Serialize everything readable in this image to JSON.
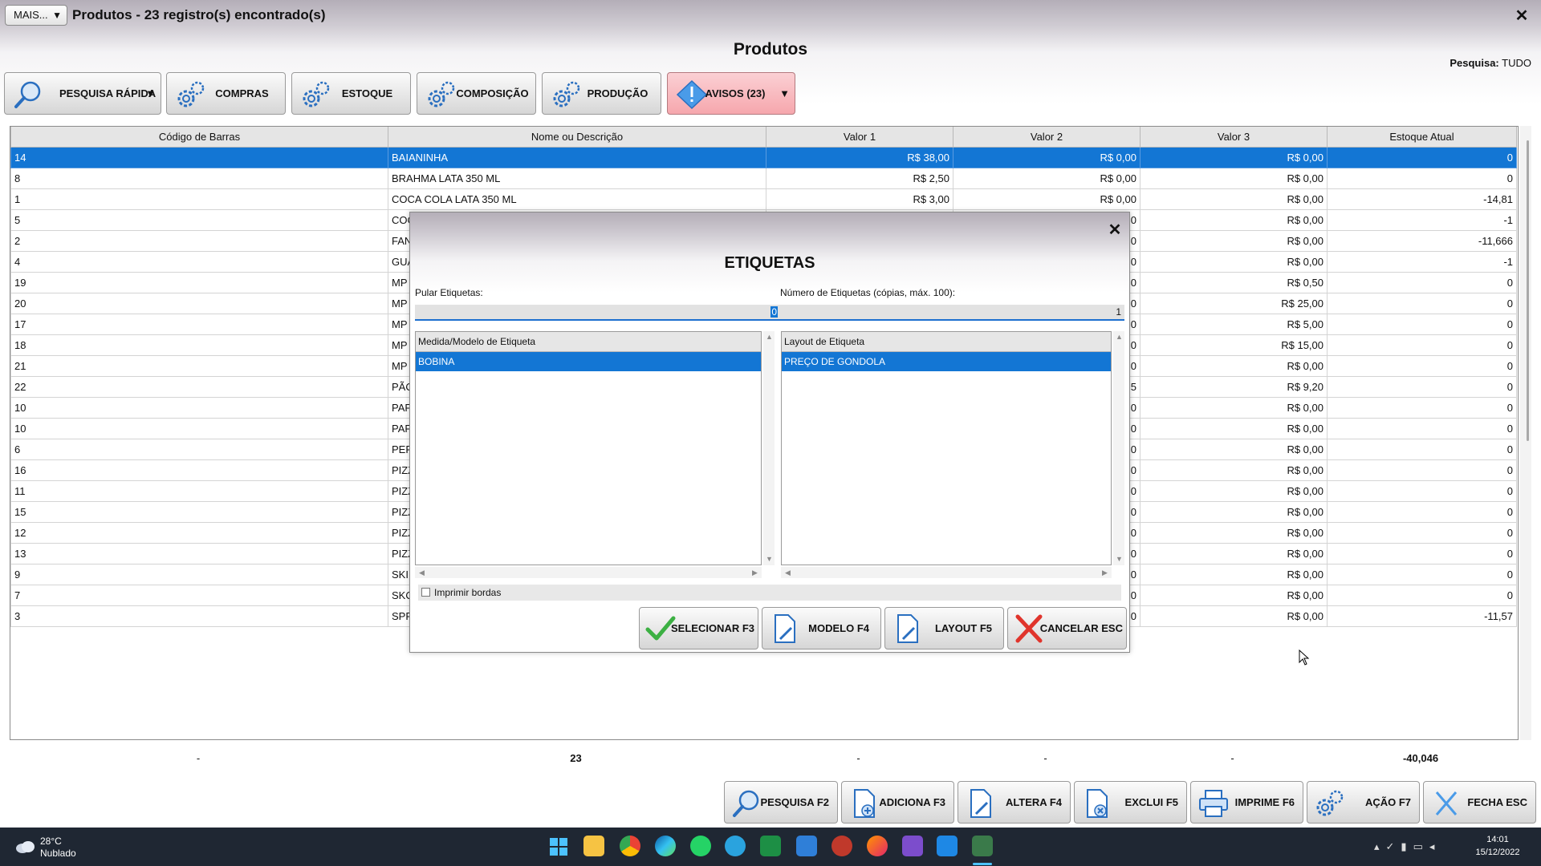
{
  "window": {
    "more_button": "MAIS...",
    "title": "Produtos - 23 registro(s) encontrado(s)",
    "close": "✕",
    "page_title": "Produtos",
    "search_label": "Pesquisa:",
    "search_value": "TUDO"
  },
  "toolbar": {
    "quick_search": "PESQUISA RÁPIDA",
    "compras": "COMPRAS",
    "estoque": "ESTOQUE",
    "composicao": "COMPOSIÇÃO",
    "producao": "PRODUÇÃO",
    "avisos": "AVISOS (23)",
    "dropdown_arrow": "▼"
  },
  "table": {
    "columns": [
      "Código de Barras",
      "Nome ou Descrição",
      "Valor 1",
      "Valor 2",
      "Valor 3",
      "Estoque Atual"
    ],
    "rows": [
      {
        "code": "14",
        "name": "BAIANINHA",
        "v1": "R$ 38,00",
        "v2": "R$ 0,00",
        "v3": "R$ 0,00",
        "stock": "0"
      },
      {
        "code": "8",
        "name": "BRAHMA LATA 350 ML",
        "v1": "R$ 2,50",
        "v2": "R$ 0,00",
        "v3": "R$ 0,00",
        "stock": "0"
      },
      {
        "code": "1",
        "name": "COCA COLA LATA 350 ML",
        "v1": "R$ 3,00",
        "v2": "R$ 0,00",
        "v3": "R$ 0,00",
        "stock": "-14,81"
      },
      {
        "code": "5",
        "name": "COC",
        "v1": "",
        "v2": "0",
        "v3": "R$ 0,00",
        "stock": "-1"
      },
      {
        "code": "2",
        "name": "FAN",
        "v1": "",
        "v2": "0",
        "v3": "R$ 0,00",
        "stock": "-11,666"
      },
      {
        "code": "4",
        "name": "GUA",
        "v1": "",
        "v2": "0",
        "v3": "R$ 0,00",
        "stock": "-1"
      },
      {
        "code": "19",
        "name": "MP",
        "v1": "",
        "v2": "0",
        "v3": "R$ 0,50",
        "stock": "0"
      },
      {
        "code": "20",
        "name": "MP",
        "v1": "",
        "v2": "0",
        "v3": "R$ 25,00",
        "stock": "0"
      },
      {
        "code": "17",
        "name": "MP",
        "v1": "",
        "v2": "0",
        "v3": "R$ 5,00",
        "stock": "0"
      },
      {
        "code": "18",
        "name": "MP",
        "v1": "",
        "v2": "0",
        "v3": "R$ 15,00",
        "stock": "0"
      },
      {
        "code": "21",
        "name": "MP",
        "v1": "",
        "v2": "0",
        "v3": "R$ 0,00",
        "stock": "0"
      },
      {
        "code": "22",
        "name": "PÃO",
        "v1": "",
        "v2": "5",
        "v3": "R$ 9,20",
        "stock": "0"
      },
      {
        "code": "10",
        "name": "PAF",
        "v1": "",
        "v2": "0",
        "v3": "R$ 0,00",
        "stock": "0"
      },
      {
        "code": "10",
        "name": "PAF",
        "v1": "",
        "v2": "0",
        "v3": "R$ 0,00",
        "stock": "0"
      },
      {
        "code": "6",
        "name": "PER",
        "v1": "",
        "v2": "0",
        "v3": "R$ 0,00",
        "stock": "0"
      },
      {
        "code": "16",
        "name": "PIZZ",
        "v1": "",
        "v2": "0",
        "v3": "R$ 0,00",
        "stock": "0"
      },
      {
        "code": "11",
        "name": "PIZZ",
        "v1": "",
        "v2": "0",
        "v3": "R$ 0,00",
        "stock": "0"
      },
      {
        "code": "15",
        "name": "PIZZ",
        "v1": "",
        "v2": "0",
        "v3": "R$ 0,00",
        "stock": "0"
      },
      {
        "code": "12",
        "name": "PIZZ",
        "v1": "",
        "v2": "0",
        "v3": "R$ 0,00",
        "stock": "0"
      },
      {
        "code": "13",
        "name": "PIZZ",
        "v1": "",
        "v2": "0",
        "v3": "R$ 0,00",
        "stock": "0"
      },
      {
        "code": "9",
        "name": "SKII",
        "v1": "",
        "v2": "0",
        "v3": "R$ 0,00",
        "stock": "0"
      },
      {
        "code": "7",
        "name": "SKO",
        "v1": "",
        "v2": "0",
        "v3": "R$ 0,00",
        "stock": "0"
      },
      {
        "code": "3",
        "name": "SPR",
        "v1": "",
        "v2": "0",
        "v3": "R$ 0,00",
        "stock": "-11,57"
      }
    ],
    "selected_index": 0
  },
  "totals": {
    "code": "-",
    "name": "23",
    "v1": "-",
    "v2": "-",
    "v3": "-",
    "stock": "-40,046"
  },
  "bottom_buttons": {
    "pesquisa": "PESQUISA F2",
    "adiciona": "ADICIONA F3",
    "altera": "ALTERA F4",
    "exclui": "EXCLUI F5",
    "imprime": "IMPRIME F6",
    "acao": "AÇÃO F7",
    "fecha": "FECHA ESC"
  },
  "modal": {
    "title": "ETIQUETAS",
    "close": "✕",
    "skip_label": "Pular Etiquetas:",
    "skip_value": "0",
    "count_label": "Número de Etiquetas (cópias, máx. 100):",
    "count_value": "1",
    "model_header": "Medida/Modelo de Etiqueta",
    "model_items": [
      "BOBINA"
    ],
    "layout_header": "Layout de Etiqueta",
    "layout_items": [
      "PREÇO DE GONDOLA"
    ],
    "print_borders_label": "Imprimir bordas",
    "print_borders_checked": false,
    "buttons": {
      "select": "SELECIONAR F3",
      "model": "MODELO F4",
      "layout": "LAYOUT F5",
      "cancel": "CANCELAR ESC"
    }
  },
  "taskbar": {
    "weather_temp": "28°C",
    "weather_condition": "Nublado",
    "time": "14:01",
    "date": "15/12/2022"
  },
  "colors": {
    "selection": "#1376d4",
    "alert_button": "#f6a7ad",
    "header_gradient_top": "#b4aeb8",
    "taskbar": "#1f2733"
  }
}
